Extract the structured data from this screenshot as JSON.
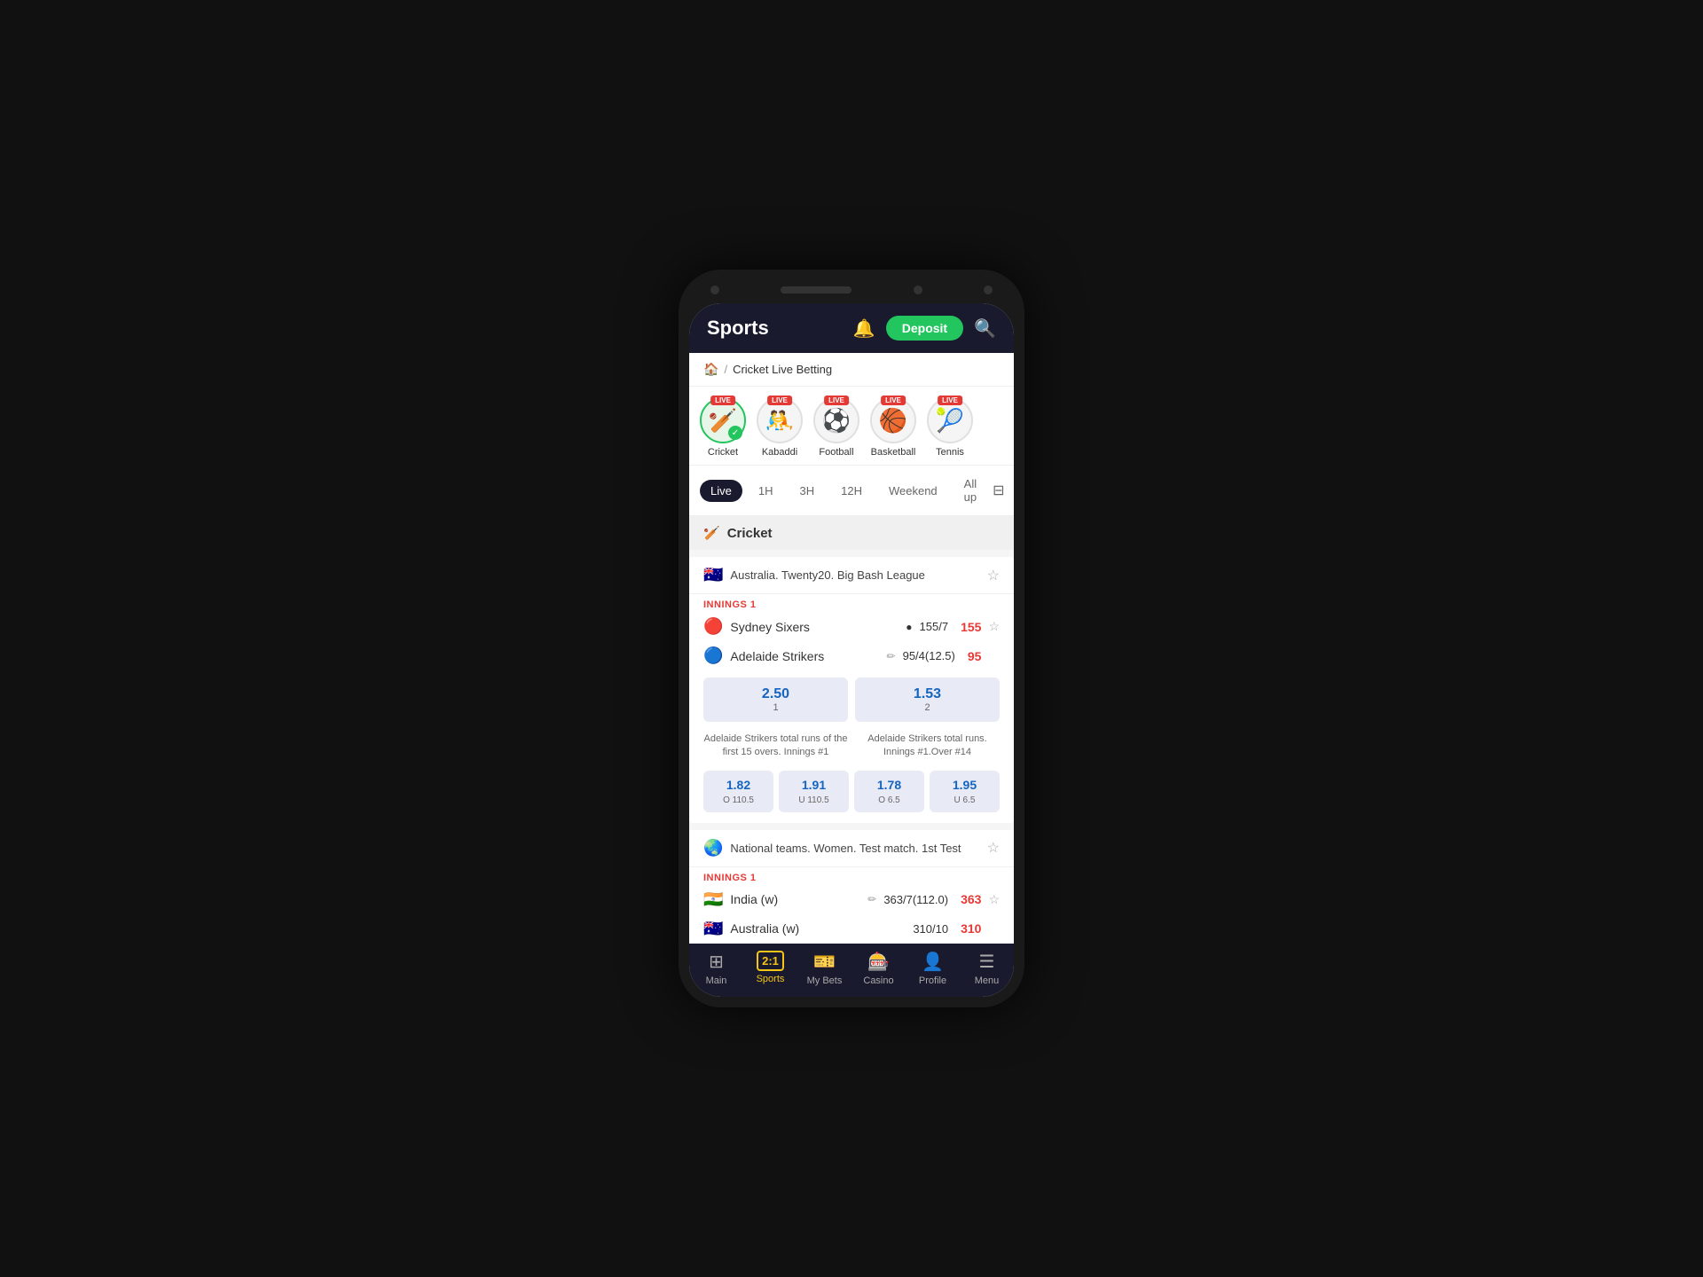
{
  "app": {
    "title": "Sports",
    "deposit_label": "Deposit"
  },
  "breadcrumb": {
    "home_icon": "🏠",
    "separator": "/",
    "current": "Cricket Live Betting"
  },
  "sports": [
    {
      "label": "Cricket",
      "icon": "🏏",
      "live": true,
      "active": true
    },
    {
      "label": "Kabaddi",
      "icon": "🤼",
      "live": true,
      "active": false
    },
    {
      "label": "Football",
      "icon": "⚽",
      "live": true,
      "active": false
    },
    {
      "label": "Basketball",
      "icon": "🏀",
      "live": true,
      "active": false
    },
    {
      "label": "Tennis",
      "icon": "🎾",
      "live": true,
      "active": false
    }
  ],
  "filter_tabs": {
    "tabs": [
      "Live",
      "1H",
      "3H",
      "12H",
      "Weekend",
      "All up"
    ],
    "active": "Live"
  },
  "section": {
    "icon": "🏏",
    "label": "Cricket"
  },
  "matches": [
    {
      "league_flag": "🇦🇺",
      "league_name": "Australia. Twenty20. Big Bash League",
      "innings_label": "INNINGS 1",
      "teams": [
        {
          "logo": "🔴",
          "name": "Sydney Sixers",
          "score": "155/7",
          "indicator": "●",
          "odds": "155",
          "odds_color": "red"
        },
        {
          "logo": "🔵",
          "name": "Adelaide Strikers",
          "score": "95/4(12.5)",
          "indicator": "✏",
          "odds": "95",
          "odds_color": "red"
        }
      ],
      "main_odds": [
        {
          "val": "2.50",
          "num": "1"
        },
        {
          "val": "1.53",
          "num": "2"
        }
      ],
      "sub_bets": [
        {
          "desc": "Adelaide Strikers total runs of the first 15 overs. Innings #1",
          "odds_items": [
            {
              "val": "1.82",
              "sub": "O 110.5"
            },
            {
              "val": "1.91",
              "sub": "U 110.5"
            }
          ]
        },
        {
          "desc": "Adelaide Strikers total runs. Innings #1.Over #14",
          "odds_items": [
            {
              "val": "1.78",
              "sub": "O 6.5"
            },
            {
              "val": "1.95",
              "sub": "U 6.5"
            }
          ]
        }
      ]
    },
    {
      "league_flag": "🌏",
      "league_name": "National teams. Women. Test match. 1st Test",
      "innings_label": "INNINGS 1",
      "teams": [
        {
          "logo": "🇮🇳",
          "name": "India (w)",
          "score": "363/7(112.0)",
          "indicator": "✏",
          "odds": "363",
          "odds_color": "red"
        },
        {
          "logo": "🇦🇺",
          "name": "Australia (w)",
          "score": "310/10",
          "indicator": "",
          "odds": "310",
          "odds_color": "red"
        }
      ],
      "main_odds": [],
      "sub_bets": []
    }
  ],
  "bottom_nav": {
    "items": [
      {
        "icon": "⊞",
        "label": "Main",
        "active": false
      },
      {
        "icon": "2:1",
        "label": "Sports",
        "active": true,
        "badge": true
      },
      {
        "icon": "🎫",
        "label": "My Bets",
        "active": false
      },
      {
        "icon": "🎰",
        "label": "Casino",
        "active": false
      },
      {
        "icon": "👤",
        "label": "Profile",
        "active": false
      },
      {
        "icon": "☰",
        "label": "Menu",
        "active": false
      }
    ]
  }
}
